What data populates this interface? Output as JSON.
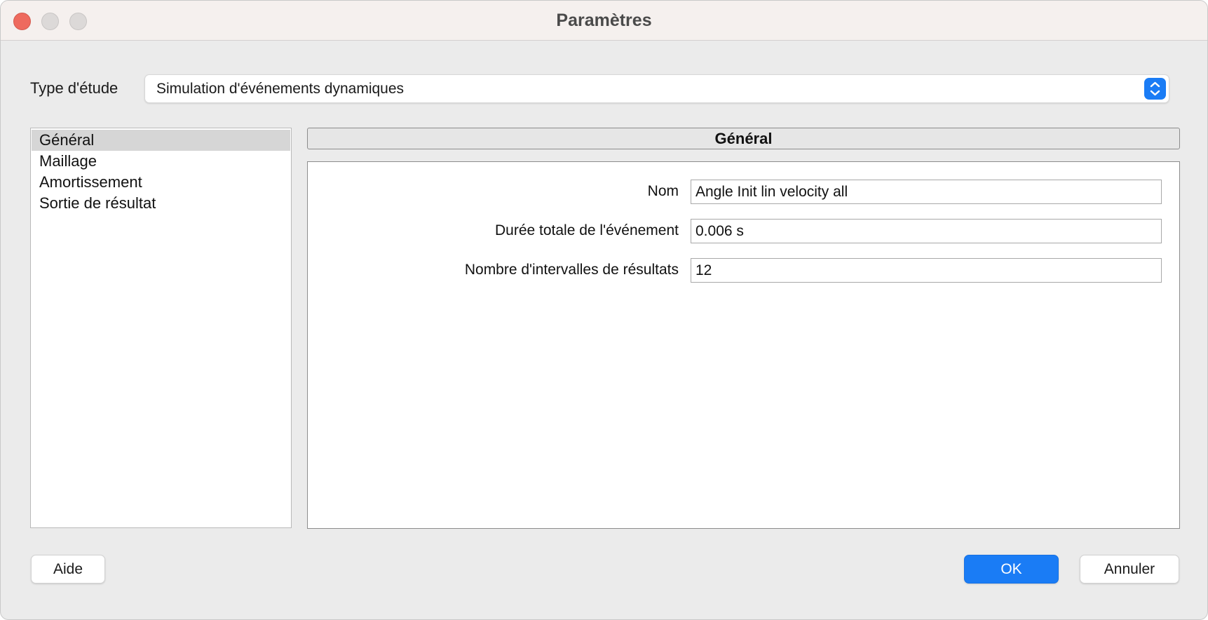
{
  "window": {
    "title": "Paramètres"
  },
  "study": {
    "label": "Type d'étude",
    "selected": "Simulation d'événements dynamiques"
  },
  "nav": {
    "items": [
      {
        "label": "Général",
        "selected": true
      },
      {
        "label": "Maillage",
        "selected": false
      },
      {
        "label": "Amortissement",
        "selected": false
      },
      {
        "label": "Sortie de résultat",
        "selected": false
      }
    ]
  },
  "section": {
    "title": "Général",
    "fields": [
      {
        "label": "Nom",
        "value": "Angle Init lin velocity all"
      },
      {
        "label": "Durée totale de l'événement",
        "value": "0.006 s"
      },
      {
        "label": "Nombre d'intervalles de résultats",
        "value": "12"
      }
    ]
  },
  "buttons": {
    "help": "Aide",
    "ok": "OK",
    "cancel": "Annuler"
  },
  "colors": {
    "accent": "#1a7cf5",
    "close": "#ee6a5e",
    "selection": "#d6d6d6"
  }
}
